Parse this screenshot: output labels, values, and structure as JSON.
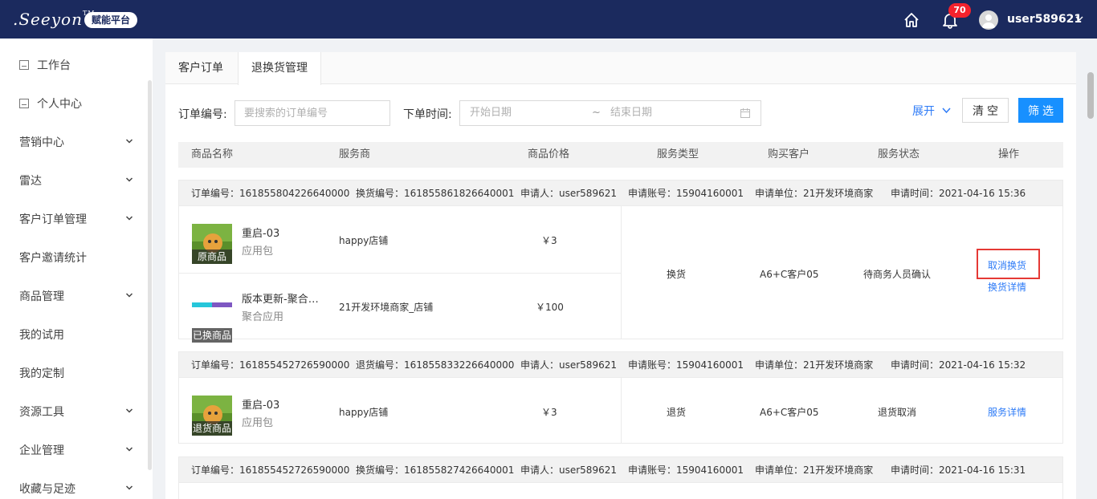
{
  "header": {
    "logo_text": ".Seeyon",
    "logo_tm": "TM",
    "platform_badge": "赋能平台",
    "notification_count": "70",
    "username": "user589621",
    "colors": {
      "bg": "#1b2a5e",
      "badge": "#f5222d"
    },
    "icons": [
      "home-icon",
      "bell-icon",
      "avatar-icon",
      "chevron-down-icon"
    ]
  },
  "sidebar": {
    "items": [
      {
        "label": "工作台",
        "icon": "workbench-icon",
        "expandable": false
      },
      {
        "label": "个人中心",
        "icon": "profile-icon",
        "expandable": false
      },
      {
        "label": "营销中心",
        "expandable": true
      },
      {
        "label": "雷达",
        "expandable": true
      },
      {
        "label": "客户订单管理",
        "expandable": true
      },
      {
        "label": "客户邀请统计",
        "expandable": false
      },
      {
        "label": "商品管理",
        "expandable": true
      },
      {
        "label": "我的试用",
        "expandable": false
      },
      {
        "label": "我的定制",
        "expandable": false
      },
      {
        "label": "资源工具",
        "expandable": true
      },
      {
        "label": "企业管理",
        "expandable": true
      },
      {
        "label": "收藏与足迹",
        "expandable": true
      }
    ]
  },
  "tabs": [
    {
      "label": "客户订单",
      "active": false
    },
    {
      "label": "退换货管理",
      "active": true
    }
  ],
  "filters": {
    "order_no_label": "订单编号:",
    "order_no_placeholder": "要搜索的订单编号",
    "time_label": "下单时间:",
    "date_start_placeholder": "开始日期",
    "date_separator": "~",
    "date_end_placeholder": "结束日期",
    "expand_label": "展开",
    "clear_label": "清空",
    "filter_label": "筛选",
    "accent": "#1890ff"
  },
  "table": {
    "columns": [
      "商品名称",
      "服务商",
      "商品价格",
      "服务类型",
      "购买客户",
      "服务状态",
      "操作"
    ]
  },
  "orders": [
    {
      "order_no": "订单编号：161855804226640000",
      "service_no": "换货编号：161855861826640001",
      "applicant": "申请人：user589621",
      "account": "申请账号：15904160001",
      "unit": "申请单位：21开发环境商家",
      "time": "申请时间：2021-04-16 15:36",
      "products": [
        {
          "tag": "原商品",
          "name": "重启-03",
          "category": "应用包",
          "vendor": "happy店铺",
          "price": "￥3"
        },
        {
          "tag": "已换商品",
          "name": "版本更新-聚合…",
          "category": "聚合应用",
          "vendor": "21开发环境商家_店铺",
          "price": "￥100"
        }
      ],
      "service_type": "换货",
      "customer": "A6+C客户05",
      "status": "待商务人员确认",
      "actions": [
        "取消换货",
        "换货详情"
      ]
    },
    {
      "order_no": "订单编号：161855452726590000",
      "service_no": "退货编号：161855833226640000",
      "applicant": "申请人：user589621",
      "account": "申请账号：15904160001",
      "unit": "申请单位：21开发环境商家",
      "time": "申请时间：2021-04-16 15:32",
      "products": [
        {
          "tag": "退货商品",
          "name": "重启-03",
          "category": "应用包",
          "vendor": "happy店铺",
          "price": "￥3"
        }
      ],
      "service_type": "退货",
      "customer": "A6+C客户05",
      "status": "退货取消",
      "actions": [
        "服务详情"
      ]
    },
    {
      "order_no": "订单编号：161855452726590000",
      "service_no": "换货编号：161855827426640001",
      "applicant": "申请人：user589621",
      "account": "申请账号：15904160001",
      "unit": "申请单位：21开发环境商家",
      "time": "申请时间：2021-04-16 15:31"
    }
  ]
}
